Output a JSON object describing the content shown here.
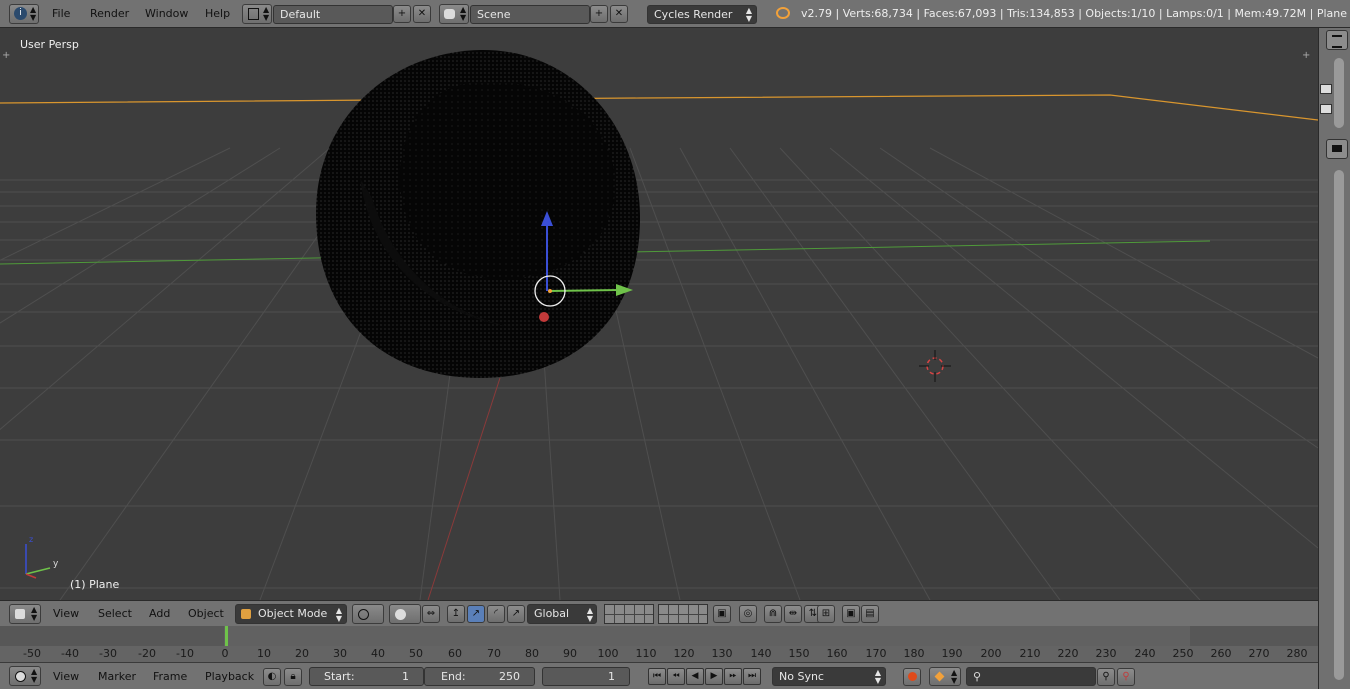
{
  "topbar": {
    "menus": [
      "File",
      "Render",
      "Window",
      "Help"
    ],
    "screen_layout": "Default",
    "scene": "Scene",
    "render_engine": "Cycles Render",
    "status": "v2.79 | Verts:68,734 | Faces:67,093 | Tris:134,853 | Objects:1/10 | Lamps:0/1 | Mem:49.72M | Plane"
  },
  "viewport": {
    "view_label": "User Persp",
    "object_label": "(1) Plane",
    "axis_y_label": "y",
    "axis_z_label": "z"
  },
  "header3d": {
    "menus": [
      "View",
      "Select",
      "Add",
      "Object"
    ],
    "mode": "Object Mode",
    "orientation": "Global"
  },
  "timeline": {
    "ticks": [
      "-50",
      "-40",
      "-30",
      "-20",
      "-10",
      "0",
      "10",
      "20",
      "30",
      "40",
      "50",
      "60",
      "70",
      "80",
      "90",
      "100",
      "110",
      "120",
      "130",
      "140",
      "150",
      "160",
      "170",
      "180",
      "190",
      "200",
      "210",
      "220",
      "230",
      "240",
      "250",
      "260",
      "270",
      "280"
    ],
    "current_frame_marker": 0
  },
  "timeline_header": {
    "menus": [
      "View",
      "Marker",
      "Frame",
      "Playback"
    ],
    "start_label": "Start:",
    "start_value": "1",
    "end_label": "End:",
    "end_value": "250",
    "current_frame": "1",
    "sync": "No Sync"
  },
  "colors": {
    "accent_orange": "#f2a13a",
    "x_axis": "#c23a3a",
    "y_axis": "#6fc24a",
    "z_axis": "#3a4fd6",
    "header_bg": "#727272",
    "viewport_bg": "#3d3d3d"
  }
}
